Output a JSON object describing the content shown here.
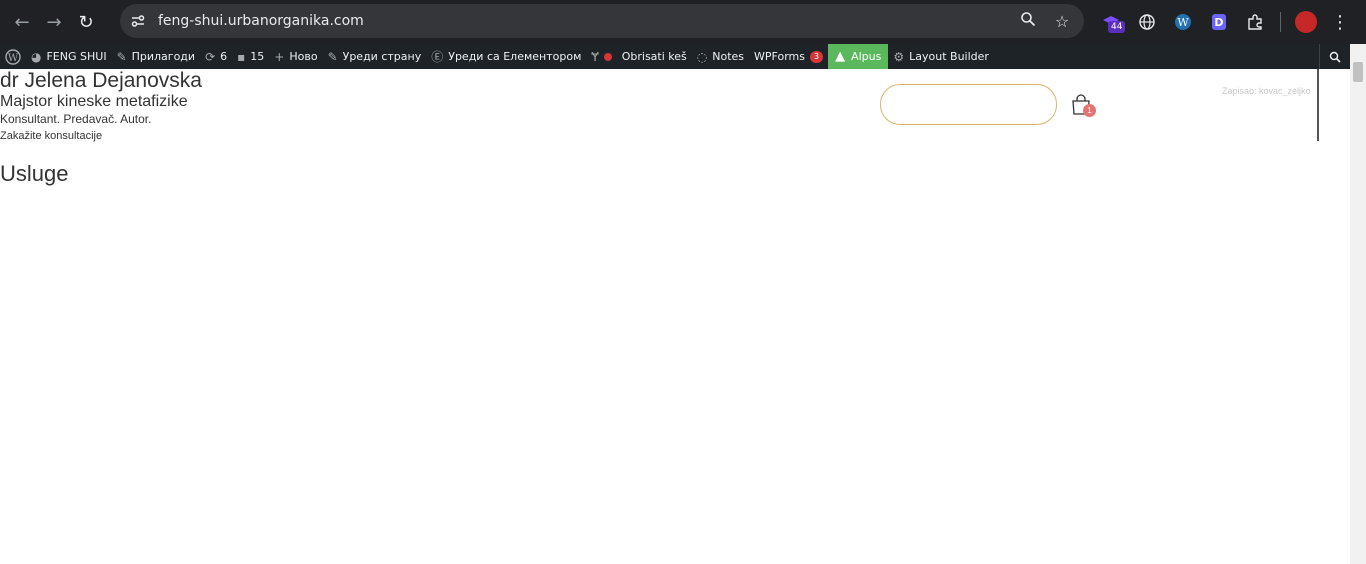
{
  "browser": {
    "url": "feng-shui.urbanorganika.com",
    "extension_badge": "44"
  },
  "admin_bar": {
    "site_name": "FENG SHUI",
    "customize": "Прилагоди",
    "updates": "6",
    "comments": "15",
    "new": "Ново",
    "edit_page": "Уреди страну",
    "edit_elementor": "Уреди са Елементором",
    "clear_cache": "Obrisati keš",
    "notes": "Notes",
    "wpforms": "WPForms",
    "wpforms_count": "3",
    "alpus": "Alpus",
    "layout_builder": "Layout Builder"
  },
  "page": {
    "title": "dr Jelena Dejanovska",
    "subtitle": "Majstor kineske metafizike",
    "tagline": "Konsultant. Predavač. Autor.",
    "cta": "Zakažite konsultacije",
    "section_heading": "Usluge",
    "cart_count": "1",
    "logged_in_text": "Zapisao: kovac_zeljko"
  }
}
